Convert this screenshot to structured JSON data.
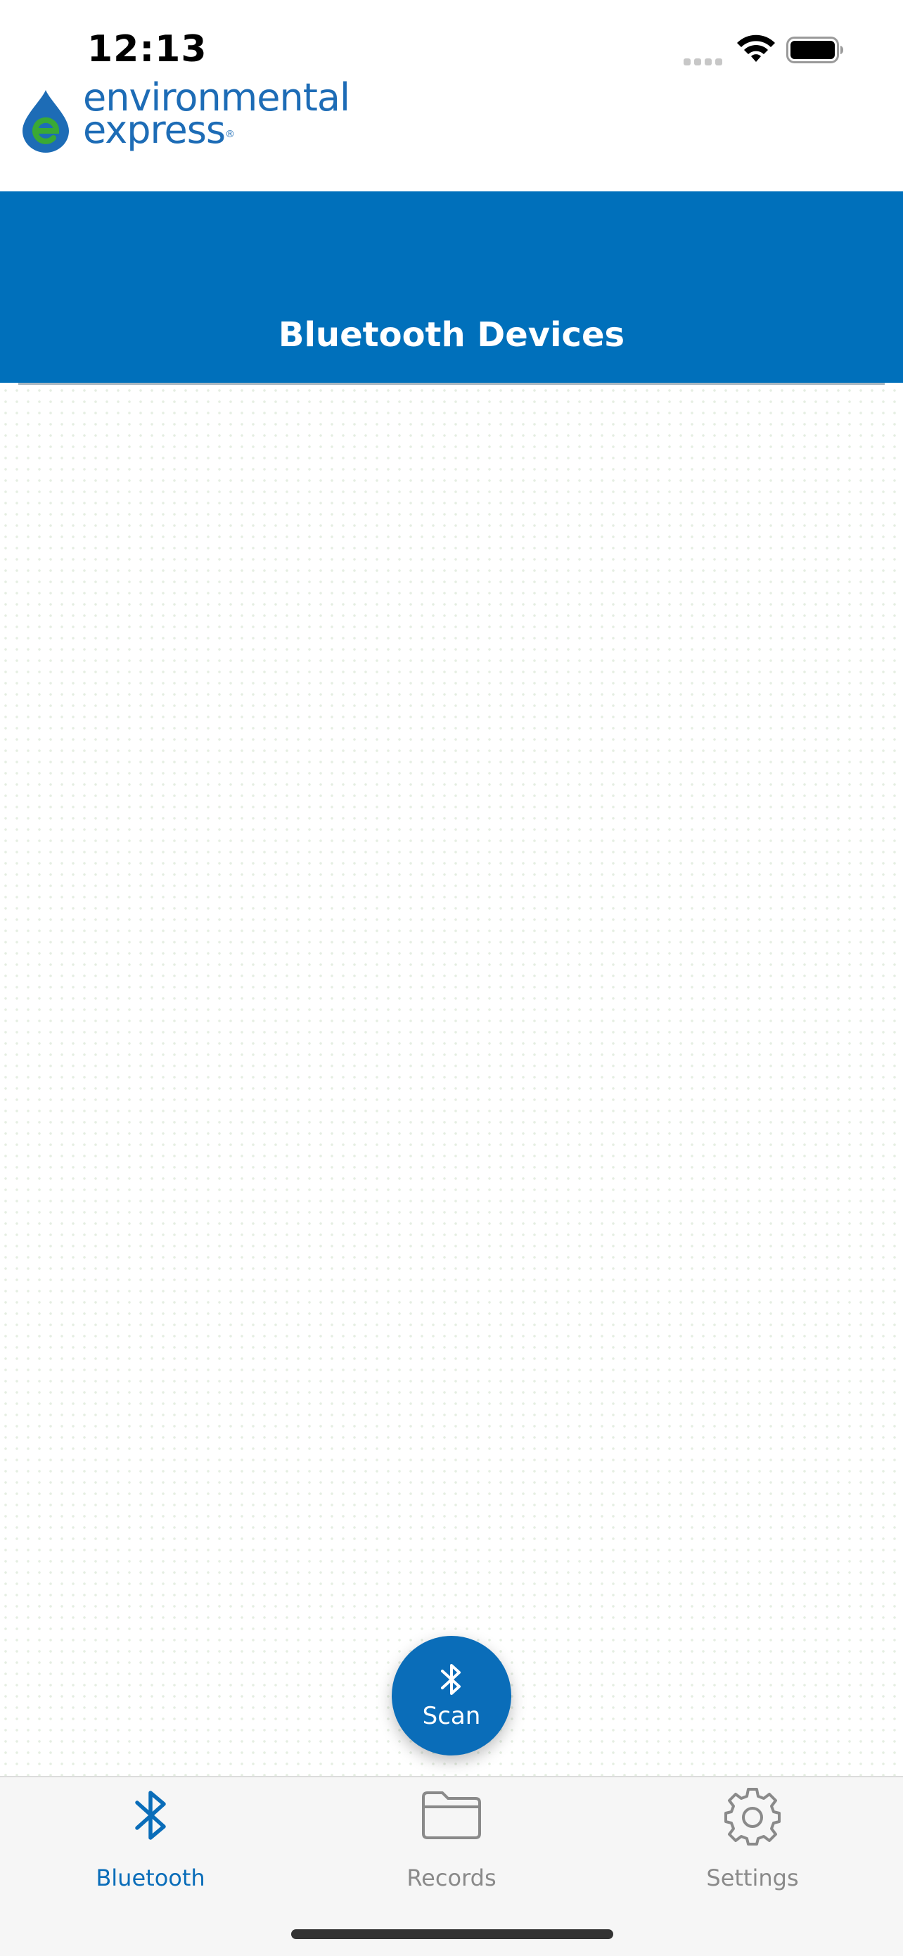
{
  "status_bar": {
    "time": "12:13",
    "signal_icon": "cellular-signal-icon",
    "wifi_icon": "wifi-icon",
    "battery_icon": "battery-icon"
  },
  "logo": {
    "line1": "environmental",
    "line2": "express",
    "registered": "®",
    "colors": {
      "blue": "#1d6cb6",
      "green": "#3aa935"
    }
  },
  "header": {
    "title": "Bluetooth Devices",
    "background_color": "#0070bb"
  },
  "scan_button": {
    "label": "Scan",
    "icon": "bluetooth-icon"
  },
  "tab_bar": {
    "tabs": [
      {
        "label": "Bluetooth",
        "icon": "bluetooth-icon",
        "active": true
      },
      {
        "label": "Records",
        "icon": "folder-icon",
        "active": false
      },
      {
        "label": "Settings",
        "icon": "gear-icon",
        "active": false
      }
    ],
    "active_color": "#0a6db9",
    "inactive_color": "#8a8a8a"
  }
}
